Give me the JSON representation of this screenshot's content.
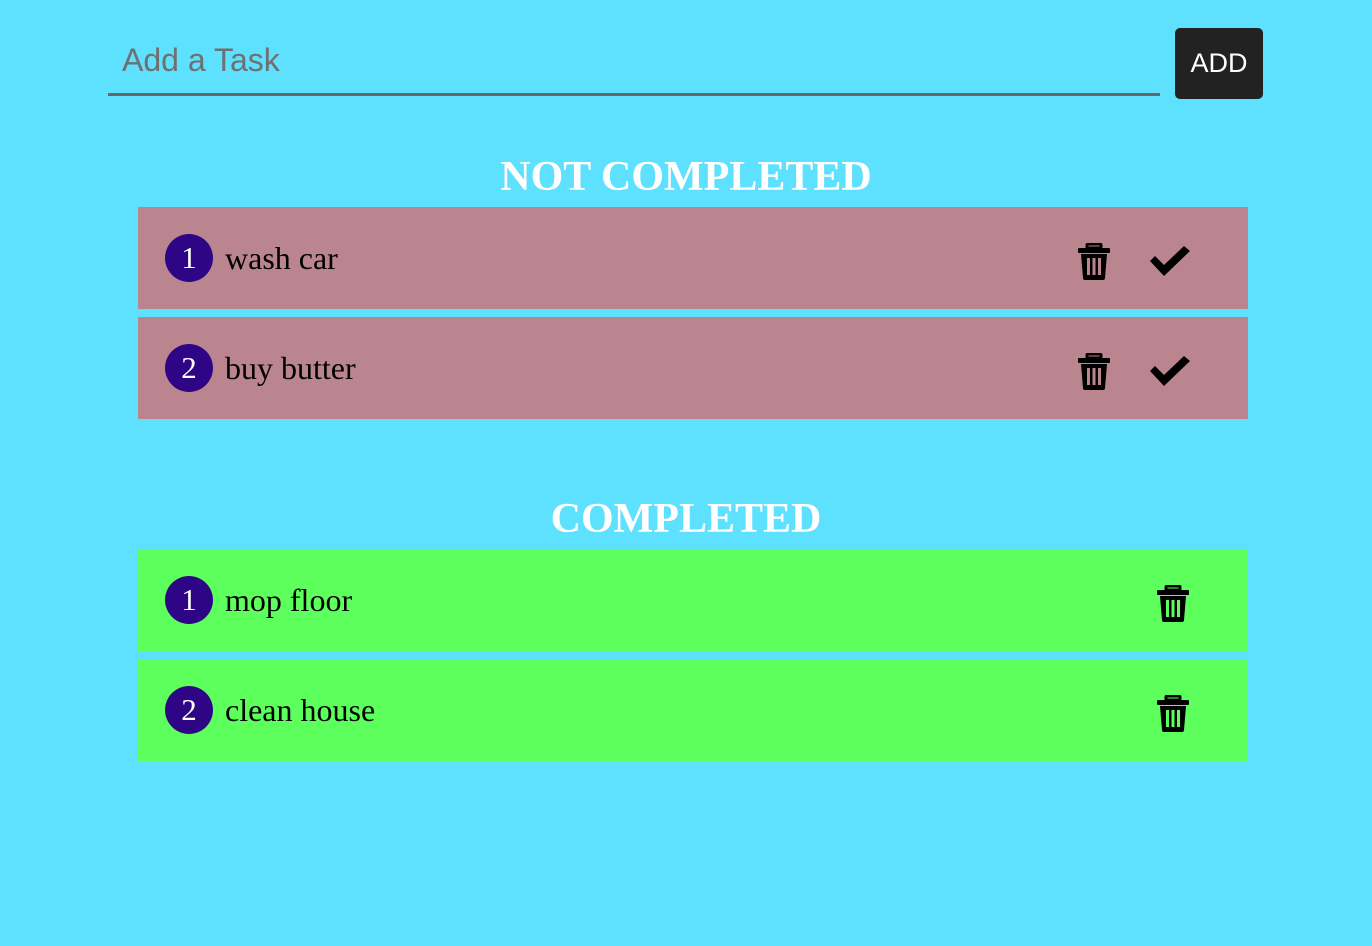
{
  "input": {
    "placeholder": "Add a Task",
    "value": ""
  },
  "add_button": {
    "label": "ADD"
  },
  "sections": {
    "not_completed": {
      "title": "NOT COMPLETED",
      "items": [
        {
          "number": "1",
          "text": "wash car"
        },
        {
          "number": "2",
          "text": "buy butter"
        }
      ]
    },
    "completed": {
      "title": "COMPLETED",
      "items": [
        {
          "number": "1",
          "text": "mop floor"
        },
        {
          "number": "2",
          "text": "clean house"
        }
      ]
    }
  },
  "icons": {
    "delete": "trash-icon",
    "complete": "checkmark-icon"
  },
  "colors": {
    "background": "#5ee0ff",
    "pending_item": "#ba858e",
    "completed_item": "#5cff5c",
    "number_badge": "#2e0685",
    "add_button": "#222222",
    "section_title": "#ffffff"
  }
}
